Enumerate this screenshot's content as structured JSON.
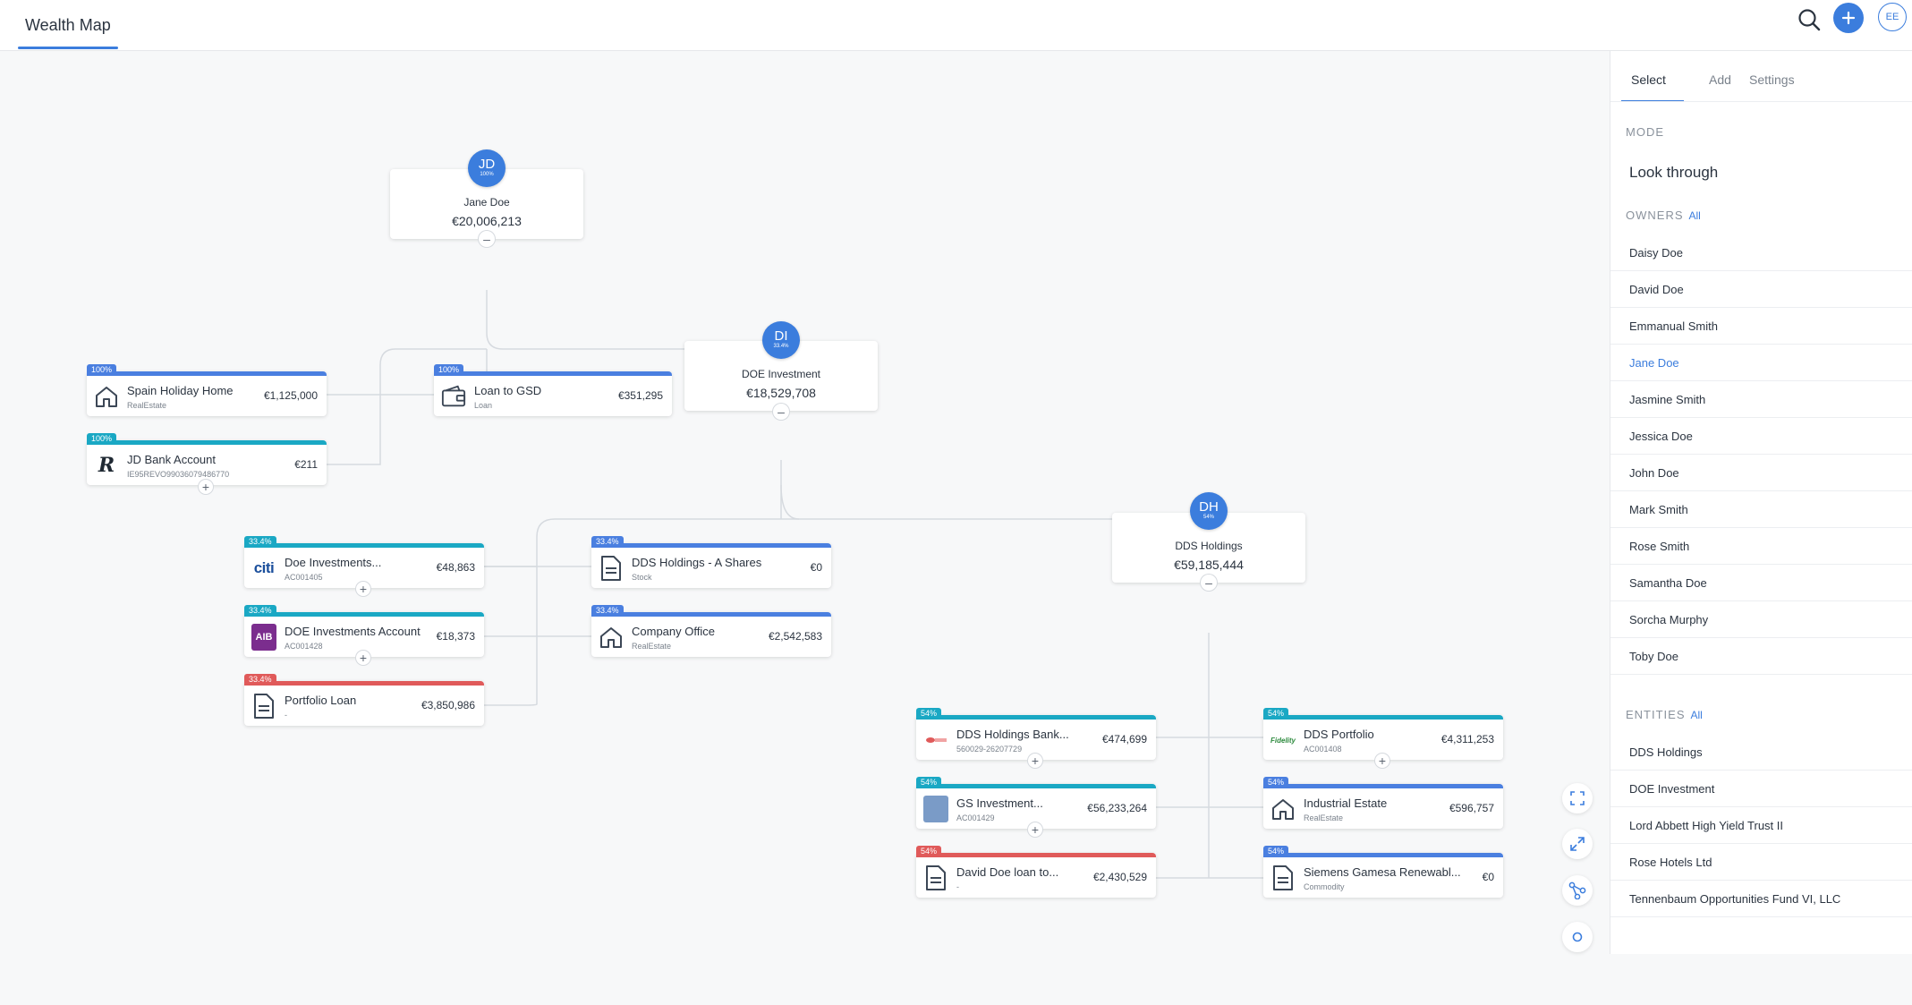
{
  "header": {
    "title": "Wealth Map",
    "avatar_initials": "EE"
  },
  "nodes": {
    "jane": {
      "initials": "JD",
      "pct": "100%",
      "name": "Jane Doe",
      "value": "€20,006,213"
    },
    "doe_inv": {
      "initials": "DI",
      "pct": "33.4%",
      "name": "DOE Investment",
      "value": "€18,529,708"
    },
    "dds": {
      "initials": "DH",
      "pct": "54%",
      "name": "DDS Holdings",
      "value": "€59,185,444"
    }
  },
  "assets": {
    "spain": {
      "tag": "100%",
      "name": "Spain Holiday Home",
      "sub": "RealEstate",
      "value": "€1,125,000",
      "color": "#4a7fe0"
    },
    "loan_gsd": {
      "tag": "100%",
      "name": "Loan to GSD",
      "sub": "Loan",
      "value": "€351,295",
      "color": "#4a7fe0"
    },
    "jd_bank": {
      "tag": "100%",
      "name": "JD Bank Account",
      "sub": "IE95REVO99036079486770",
      "value": "€211",
      "color": "#1aa8c4"
    },
    "doe_inv_citi": {
      "tag": "33.4%",
      "name": "Doe Investments...",
      "sub": "AC001405",
      "value": "€48,863",
      "color": "#1aa8c4"
    },
    "doe_inv_aib": {
      "tag": "33.4%",
      "name": "DOE Investments Account",
      "sub": "AC001428",
      "value": "€18,373",
      "color": "#1aa8c4"
    },
    "portfolio_loan": {
      "tag": "33.4%",
      "name": "Portfolio Loan",
      "sub": "-",
      "value": "€3,850,986",
      "color": "#e05a5a"
    },
    "dds_a_shares": {
      "tag": "33.4%",
      "name": "DDS Holdings - A Shares",
      "sub": "Stock",
      "value": "€0",
      "color": "#4a7fe0"
    },
    "company_office": {
      "tag": "33.4%",
      "name": "Company Office",
      "sub": "RealEstate",
      "value": "€2,542,583",
      "color": "#4a7fe0"
    },
    "dds_bank": {
      "tag": "54%",
      "name": "DDS Holdings Bank...",
      "sub": "560029-26207729",
      "value": "€474,699",
      "color": "#1aa8c4"
    },
    "gs_inv": {
      "tag": "54%",
      "name": "GS Investment...",
      "sub": "AC001429",
      "value": "€56,233,264",
      "color": "#1aa8c4"
    },
    "david_loan": {
      "tag": "54%",
      "name": "David Doe loan to...",
      "sub": "-",
      "value": "€2,430,529",
      "color": "#e05a5a"
    },
    "dds_portfolio": {
      "tag": "54%",
      "name": "DDS Portfolio",
      "sub": "AC001408",
      "value": "€4,311,253",
      "color": "#1aa8c4"
    },
    "industrial": {
      "tag": "54%",
      "name": "Industrial Estate",
      "sub": "RealEstate",
      "value": "€596,757",
      "color": "#4a7fe0"
    },
    "siemens": {
      "tag": "54%",
      "name": "Siemens Gamesa Renewabl...",
      "sub": "Commodity",
      "value": "€0",
      "color": "#4a7fe0"
    }
  },
  "panel": {
    "tabs": [
      "Select",
      "Add",
      "Settings"
    ],
    "mode_label": "MODE",
    "mode_value": "Look through",
    "owners_label": "OWNERS",
    "owners_link": "All",
    "owners": [
      "Daisy Doe",
      "David Doe",
      "Emmanual Smith",
      "Jane Doe",
      "Jasmine Smith",
      "Jessica Doe",
      "John Doe",
      "Mark Smith",
      "Rose Smith",
      "Samantha Doe",
      "Sorcha Murphy",
      "Toby Doe"
    ],
    "selected_owner": "Jane Doe",
    "entities_label": "ENTITIES",
    "entities_link": "All",
    "entities": [
      "DDS Holdings",
      "DOE Investment",
      "Lord Abbett High Yield Trust II",
      "Rose Hotels Ltd",
      "Tennenbaum Opportunities Fund VI, LLC"
    ]
  },
  "colors": {
    "accent": "#3b7ddd",
    "card_blue": "#4a7fe0",
    "card_teal": "#1aa8c4",
    "card_red": "#e05a5a"
  }
}
